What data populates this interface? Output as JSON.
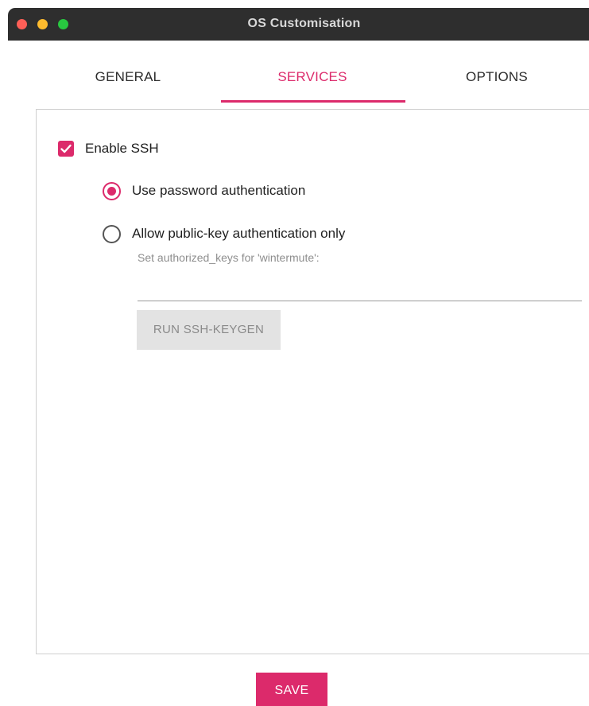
{
  "window": {
    "title": "OS Customisation"
  },
  "tabs": [
    {
      "label": "GENERAL",
      "active": false
    },
    {
      "label": "SERVICES",
      "active": true
    },
    {
      "label": "OPTIONS",
      "active": false
    }
  ],
  "services": {
    "enable_ssh": {
      "label": "Enable SSH",
      "checked": true
    },
    "auth_options": [
      {
        "label": "Use password authentication",
        "selected": true
      },
      {
        "label": "Allow public-key authentication only",
        "selected": false
      }
    ],
    "authorized_keys": {
      "hint": "Set authorized_keys for 'wintermute':",
      "value": ""
    },
    "keygen_label": "RUN SSH-KEYGEN"
  },
  "footer": {
    "save_label": "SAVE"
  },
  "colors": {
    "accent": "#dc2a6b",
    "titlebar": "#2e2e2e"
  }
}
